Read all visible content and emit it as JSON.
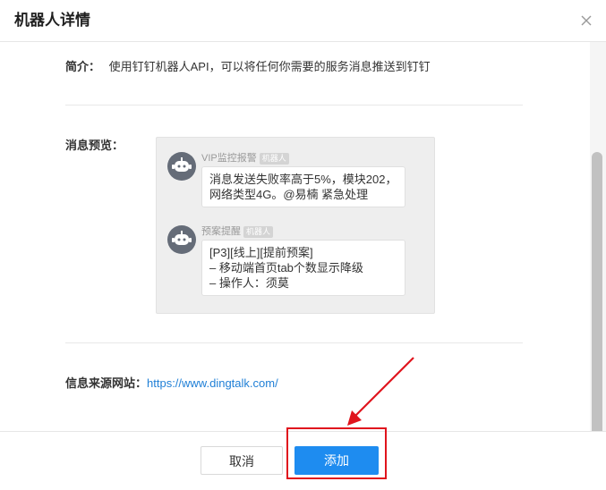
{
  "dialog": {
    "title": "机器人详情",
    "close_icon": "close-icon"
  },
  "intro": {
    "label": "简介：",
    "text": "使用钉钉机器人API，可以将任何你需要的服务消息推送到钉钉"
  },
  "preview": {
    "label": "消息预览：",
    "messages": [
      {
        "sender": "VIP监控报警",
        "badge": "机器人",
        "lines": [
          "消息发送失败率高于5%，模块202，",
          "网络类型4G。@易楠 紧急处理"
        ]
      },
      {
        "sender": "预案提醒",
        "badge": "机器人",
        "lines": [
          "[P3][线上][提前预案]",
          "– 移动端首页tab个数显示降级",
          "– 操作人：须莫"
        ]
      }
    ]
  },
  "source": {
    "label": "信息来源网站：",
    "url": "https://www.dingtalk.com/"
  },
  "footer": {
    "cancel_label": "取消",
    "add_label": "添加"
  },
  "colors": {
    "primary": "#1e8cf0",
    "highlight": "#e0141d",
    "link": "#1f7fd6"
  }
}
